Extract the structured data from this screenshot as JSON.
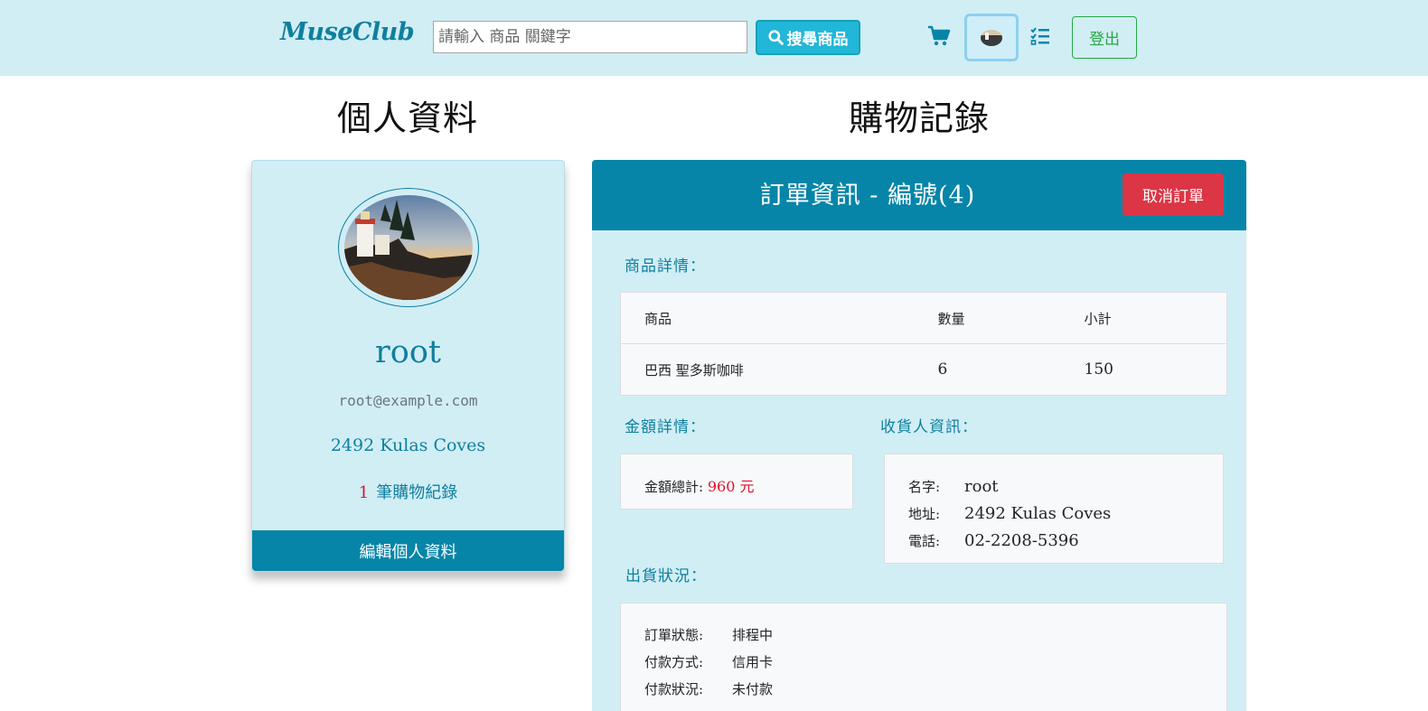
{
  "navbar": {
    "brand": "MuseClub",
    "search_placeholder": "請輸入 商品 關鍵字",
    "search_button": "搜尋商品",
    "logout_button": "登出"
  },
  "profile": {
    "heading": "個人資料",
    "name": "root",
    "email": "root@example.com",
    "address": "2492 Kulas Coves",
    "order_count": "1",
    "order_count_suffix": "筆購物紀錄",
    "edit_button": "編輯個人資料"
  },
  "orders": {
    "heading": "購物記錄",
    "order_title": "訂單資訊 - 編號(4)",
    "cancel_button": "取消訂單",
    "items_label": "商品詳情：",
    "table": {
      "columns": [
        "商品",
        "數量",
        "小計"
      ],
      "rows": [
        [
          "巴西 聖多斯咖啡",
          "6",
          "150"
        ]
      ]
    },
    "amount_label": "金額詳情：",
    "amount_total_label": "金額總計:",
    "amount_total_value": "960 元",
    "recipient_label": "收貨人資訊：",
    "recipient": [
      {
        "key": "名字:",
        "value": "root"
      },
      {
        "key": "地址:",
        "value": "2492 Kulas Coves"
      },
      {
        "key": "電話:",
        "value": "02-2208-5396"
      }
    ],
    "shipping_label": "出貨狀況：",
    "shipping": [
      {
        "key": "訂單狀態:",
        "value": "排程中"
      },
      {
        "key": "付款方式:",
        "value": "信用卡"
      },
      {
        "key": "付款狀況:",
        "value": "未付款"
      }
    ]
  },
  "colors": {
    "navbar_bg": "#d1eef5",
    "primary": "#0685a8",
    "info": "#22b7d8",
    "danger": "#dc3545",
    "success": "#28a745",
    "price": "#e0102f"
  },
  "icons": {
    "search": "search-icon",
    "cart": "cart-icon",
    "list": "list-check-icon"
  }
}
